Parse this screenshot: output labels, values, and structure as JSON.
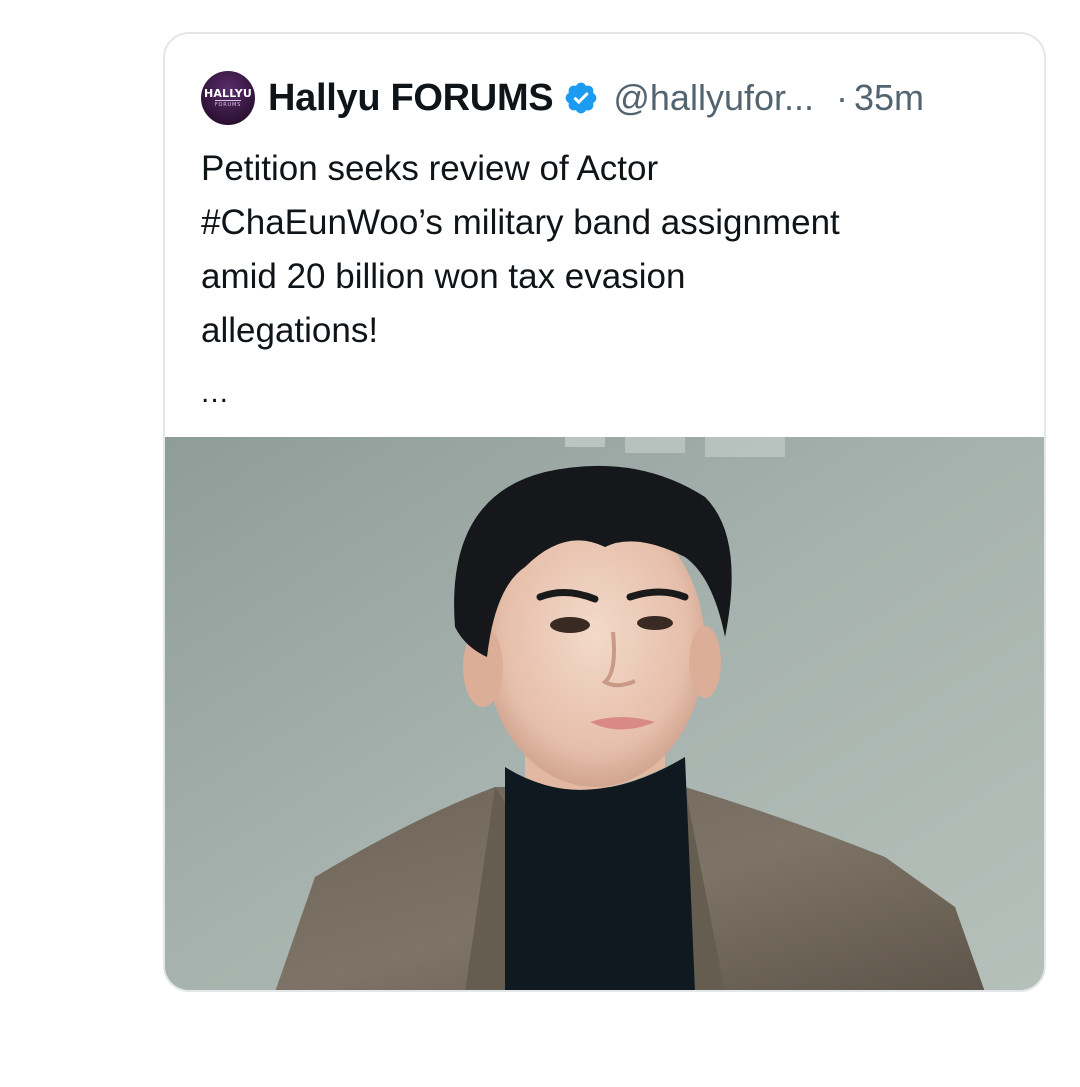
{
  "quote": {
    "avatar": {
      "brand": "HALLYU",
      "sub": "FORUMS",
      "bg_color": "#2e1236"
    },
    "author": {
      "display_name": "Hallyu FORUMS",
      "verified": true,
      "verified_color": "#1d9bf0",
      "handle": "@hallyufor...",
      "separator": "·",
      "time": "35m"
    },
    "text_lines": [
      "Petition seeks review of Actor",
      "#ChaEunWoo’s military band assignment",
      "amid 20 billion won tax evasion",
      "allegations!"
    ],
    "truncation": "...",
    "media": {
      "kind": "photo",
      "icon": "photo-of-person"
    }
  }
}
